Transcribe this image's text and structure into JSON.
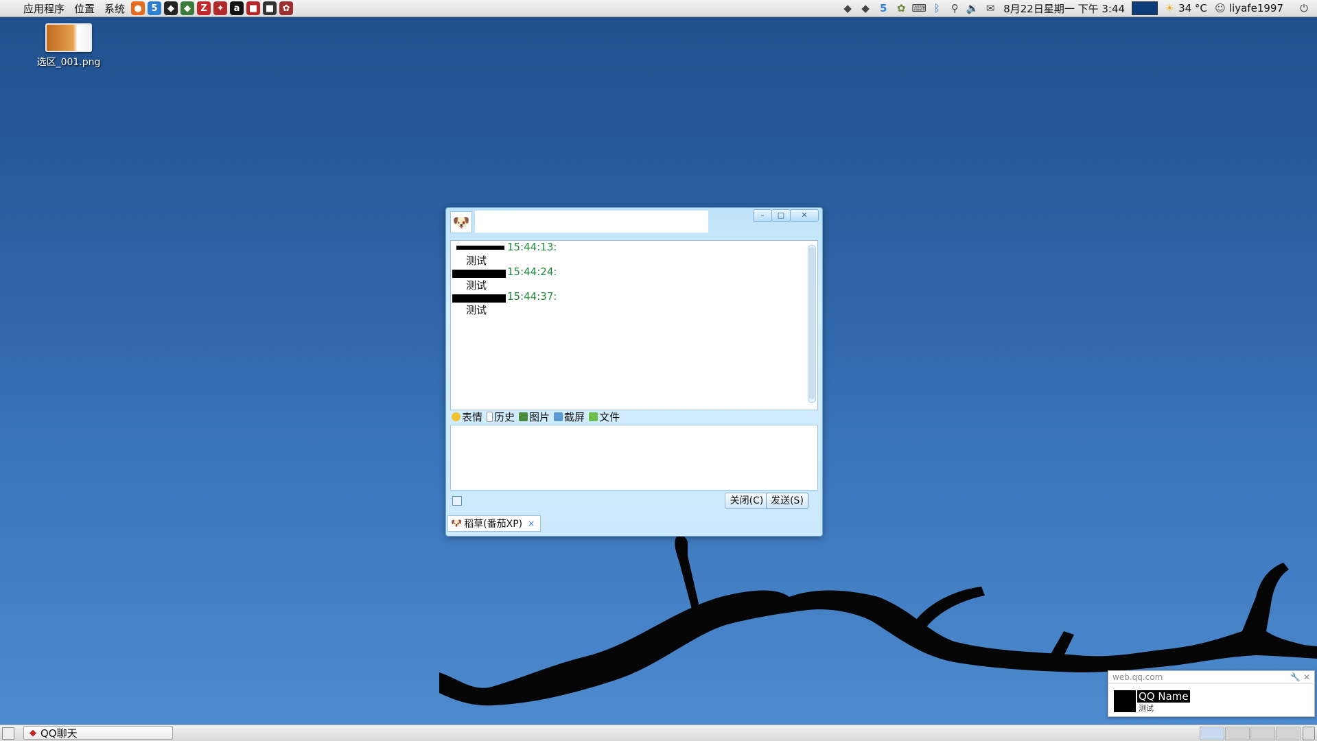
{
  "top_panel": {
    "menus": [
      "应用程序",
      "位置",
      "系统"
    ],
    "launchers": [
      {
        "name": "firefox-icon",
        "glyph": "●",
        "color": "#e66b1c"
      },
      {
        "name": "html5-icon",
        "glyph": "5",
        "color": "#2f7fd1"
      },
      {
        "name": "qq-penguin-icon",
        "glyph": "◆",
        "color": "#222222"
      },
      {
        "name": "qq-icon",
        "glyph": "◆",
        "color": "#3a7a3a"
      },
      {
        "name": "filezilla-icon",
        "glyph": "Z",
        "color": "#c0282b"
      },
      {
        "name": "tool-icon",
        "glyph": "✦",
        "color": "#b02a2a"
      },
      {
        "name": "record-icon",
        "glyph": "a",
        "color": "#111111"
      },
      {
        "name": "terminal-red-icon",
        "glyph": "■",
        "color": "#b7262b"
      },
      {
        "name": "terminal-icon",
        "glyph": "■",
        "color": "#333333"
      },
      {
        "name": "settings-app-icon",
        "glyph": "✿",
        "color": "#9c3030"
      }
    ],
    "tray": {
      "datetime": "8月22日星期一 下午 3:44",
      "temperature": "34 °C",
      "username": "liyafe1997"
    }
  },
  "desktop": {
    "file_label": "选区_001.png"
  },
  "qq_window": {
    "messages": [
      {
        "time": "15:44:13:",
        "text": "测试"
      },
      {
        "time": "15:44:24:",
        "text": "测试"
      },
      {
        "time": "15:44:37:",
        "text": "测试"
      }
    ],
    "toolbar": {
      "emoji": "表情",
      "history": "历史",
      "image": "图片",
      "screenshot": "截屏",
      "file": "文件"
    },
    "buttons": {
      "close": "关闭(C)",
      "send": "发送(S)"
    },
    "tab_label": "稻草(番茄XP)",
    "tab_close": "×"
  },
  "notification": {
    "source": "web.qq.com",
    "name": "QQ Name",
    "message": "测试"
  },
  "taskbar": {
    "task_label": "QQ聊天"
  }
}
